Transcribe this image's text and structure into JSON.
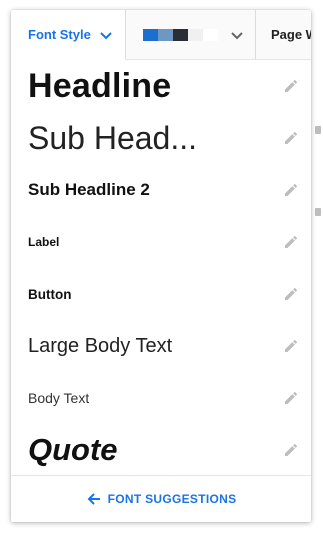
{
  "toolbar": {
    "font_style_label": "Font Style",
    "page_label": "Page W",
    "swatch_colors": [
      "#1c6fd1",
      "#6f97c4",
      "#2a2d33",
      "#f0f0f0",
      "#ffffff"
    ]
  },
  "font_styles": [
    {
      "label": "Headline"
    },
    {
      "label": "Sub Head..."
    },
    {
      "label": "Sub Headline 2"
    },
    {
      "label": "Label"
    },
    {
      "label": "Button"
    },
    {
      "label": "Large Body Text"
    },
    {
      "label": "Body Text"
    },
    {
      "label": "Quote"
    }
  ],
  "footer": {
    "label": "FONT SUGGESTIONS"
  },
  "colors": {
    "accent": "#1a73e8",
    "icon_gray": "#bdbdbd"
  }
}
